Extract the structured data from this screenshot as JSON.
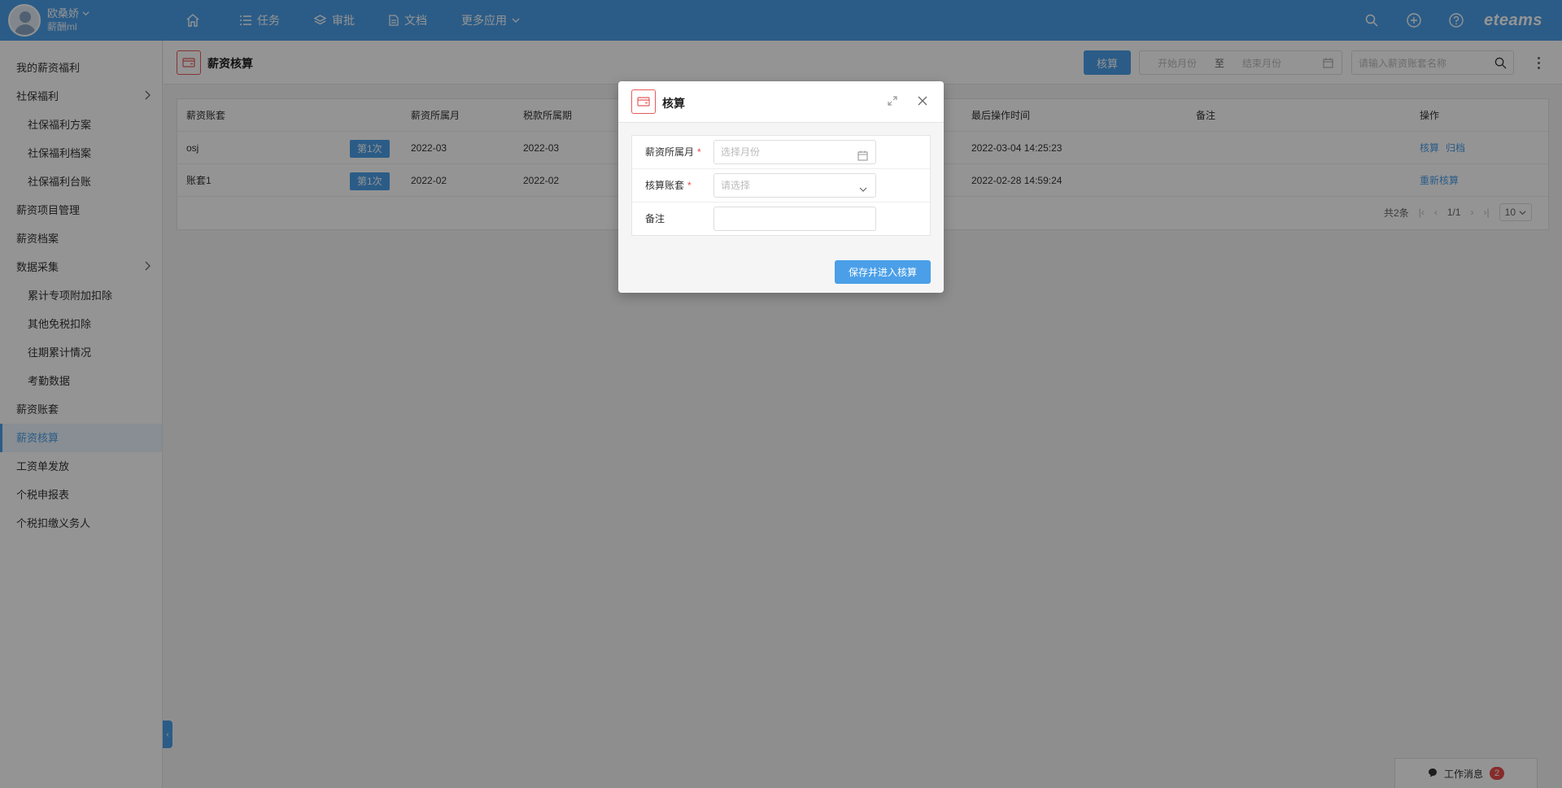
{
  "user": {
    "name": "欧桑娇",
    "sub": "薪酬ml"
  },
  "nav": [
    {
      "label": ""
    },
    {
      "label": "任务"
    },
    {
      "label": "审批"
    },
    {
      "label": "文档"
    },
    {
      "label": "更多应用"
    }
  ],
  "brand": "eteams",
  "sidebar": {
    "items": [
      {
        "label": "我的薪资福利"
      },
      {
        "label": "社保福利"
      },
      {
        "label": "社保福利方案"
      },
      {
        "label": "社保福利档案"
      },
      {
        "label": "社保福利台账"
      },
      {
        "label": "薪资项目管理"
      },
      {
        "label": "薪资档案"
      },
      {
        "label": "数据采集"
      },
      {
        "label": "累计专项附加扣除"
      },
      {
        "label": "其他免税扣除"
      },
      {
        "label": "往期累计情况"
      },
      {
        "label": "考勤数据"
      },
      {
        "label": "薪资账套"
      },
      {
        "label": "薪资核算"
      },
      {
        "label": "工资单发放"
      },
      {
        "label": "个税申报表"
      },
      {
        "label": "个税扣缴义务人"
      }
    ]
  },
  "page": {
    "title": "薪资核算",
    "calc_button": "核算",
    "range_start_placeholder": "开始月份",
    "range_to": "至",
    "range_end_placeholder": "结束月份",
    "search_placeholder": "请输入薪资账套名称"
  },
  "table": {
    "headers": [
      "薪资账套",
      "薪资所属月",
      "税款所属期",
      "最后操作时间",
      "备注",
      "操作"
    ],
    "rows": [
      {
        "account": "osj",
        "tag": "第1次",
        "salary_month": "2022-03",
        "tax_period": "2022-03",
        "last_op": "2022-03-04 14:25:23",
        "note": "",
        "action1": "核算",
        "action2": "归档"
      },
      {
        "account": "账套1",
        "tag": "第1次",
        "salary_month": "2022-02",
        "tax_period": "2022-02",
        "last_op": "2022-02-28 14:59:24",
        "note": "",
        "action1": "重新核算",
        "action2": ""
      }
    ],
    "pager": {
      "total": "共2条",
      "page": "1/1",
      "size": "10"
    }
  },
  "message_button": {
    "label": "工作消息",
    "count": "2"
  },
  "modal": {
    "title": "核算",
    "fields": [
      {
        "label": "薪资所属月",
        "placeholder": "选择月份",
        "required": true
      },
      {
        "label": "核算账套",
        "placeholder": "请选择",
        "required": true
      },
      {
        "label": "备注",
        "placeholder": "",
        "required": false
      }
    ],
    "submit": "保存并进入核算"
  },
  "colors": {
    "primary": "#4a9fe8",
    "accent_red": "#e85a5a",
    "badge": "#e84a4a"
  }
}
